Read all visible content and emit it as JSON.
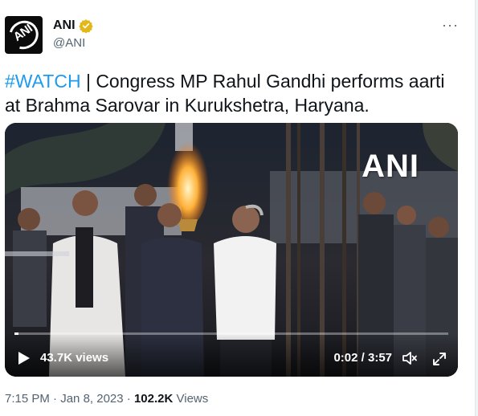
{
  "account": {
    "display_name": "ANI",
    "handle": "@ANI",
    "avatar_text": "ANI"
  },
  "tweet": {
    "hashtag": "#WATCH",
    "text": " | Congress MP Rahul Gandhi performs aarti at Brahma Sarovar in Kurukshetra, Haryana."
  },
  "video": {
    "views": "43.7K views",
    "time": "0:02 / 3:57",
    "watermark": "ANI",
    "progress": 0.0084
  },
  "meta": {
    "time": "7:15 PM",
    "sep1": " · ",
    "date": "Jan 8, 2023",
    "sep2": " · ",
    "views_count": "102.2K",
    "views_label": " Views"
  },
  "colors": {
    "accent": "#1d9bf0",
    "verified": "#e2b719",
    "muted": "#536471"
  },
  "icons": [
    "verified-badge-icon",
    "more-icon",
    "play-icon",
    "volume-icon",
    "fullscreen-icon"
  ]
}
